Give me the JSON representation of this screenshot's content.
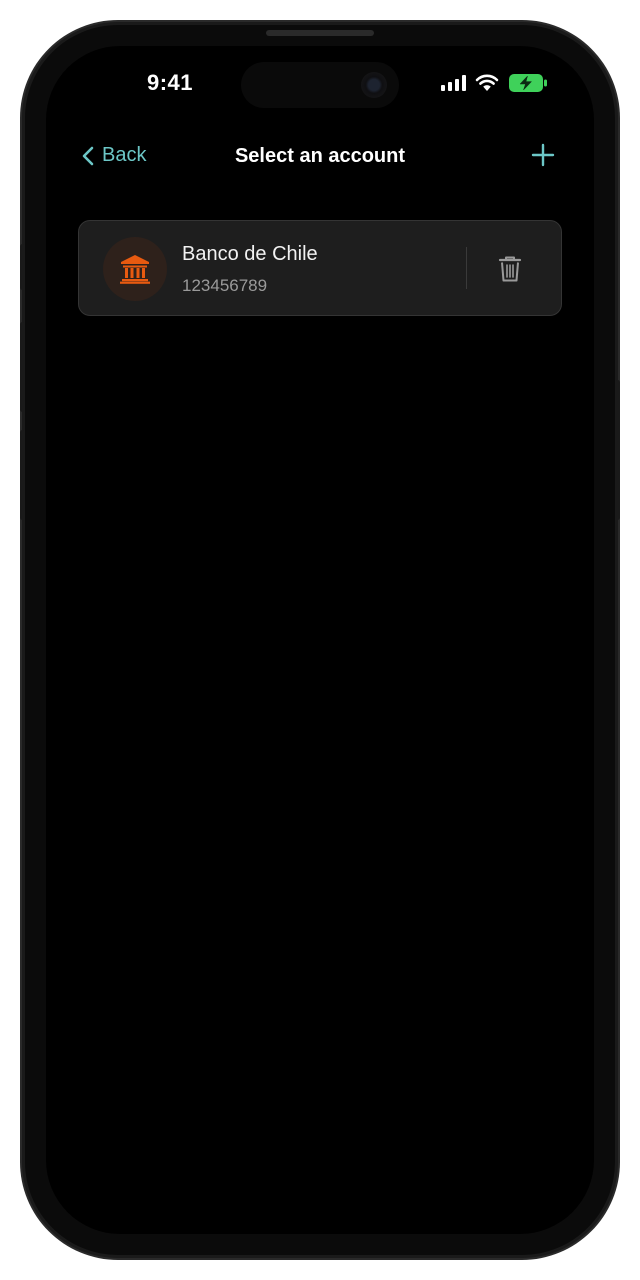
{
  "status_bar": {
    "time": "9:41",
    "battery_color": "#3fd15a"
  },
  "nav": {
    "back_label": "Back",
    "title": "Select an account",
    "accent_color": "#6cc7c7"
  },
  "accounts": [
    {
      "bank_name": "Banco de Chile",
      "account_number": "123456789",
      "icon": "bank-icon",
      "icon_color": "#e85a10"
    }
  ],
  "icons": {
    "back": "chevron-left-icon",
    "add": "plus-icon",
    "delete": "trash-icon"
  }
}
